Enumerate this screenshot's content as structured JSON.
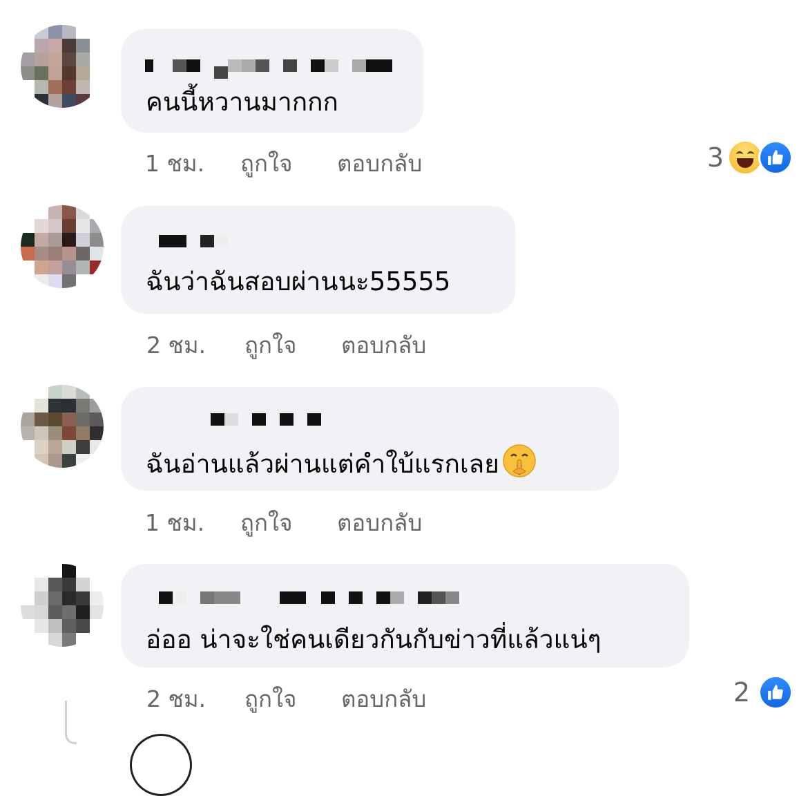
{
  "comments": [
    {
      "text": "คนนี้หวานมากกก",
      "time": "1 ชม.",
      "like_label": "ถูกใจ",
      "reply_label": "ตอบกลับ",
      "reaction_count": "3",
      "reactions": [
        "haha-icon",
        "like-icon"
      ]
    },
    {
      "text": "ฉันว่าฉันสอบผ่านนะ55555",
      "time": "2 ชม.",
      "like_label": "ถูกใจ",
      "reply_label": "ตอบกลับ"
    },
    {
      "text": "ฉันอ่านแล้วผ่านแต่คำใบ้แรกเลย",
      "emoji": "shushing-face-icon",
      "time": "1 ชม.",
      "like_label": "ถูกใจ",
      "reply_label": "ตอบกลับ"
    },
    {
      "text": "อ่ออ น่าจะใช่คนเดียวกันกับข่าวที่แล้วแน่ๆ",
      "time": "2 ชม.",
      "like_label": "ถูกใจ",
      "reply_label": "ตอบกลับ",
      "reaction_count": "2",
      "reactions": [
        "like-icon"
      ]
    }
  ],
  "colors": {
    "bubble": "#f0f2f5",
    "text": "#050505",
    "meta": "#65676b",
    "like_blue": "#1877f2"
  }
}
